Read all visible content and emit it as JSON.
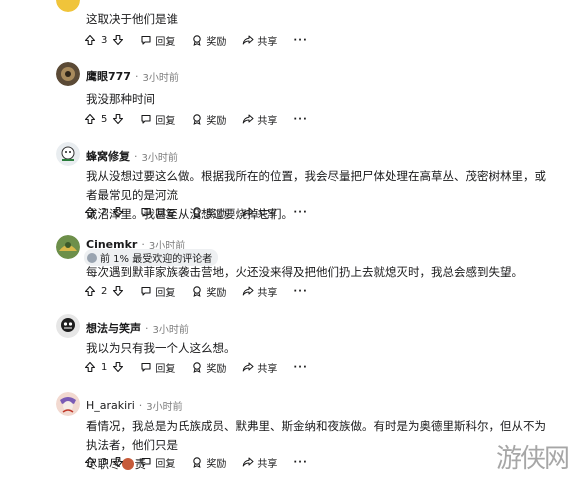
{
  "labels": {
    "reply": "回复",
    "award": "奖励",
    "share": "共享",
    "more": "···"
  },
  "comments": [
    {
      "author": "",
      "time": "",
      "text": "这取决于他们是谁",
      "votes": "3"
    },
    {
      "author": "鹰眼777",
      "time": "3小时前",
      "text": "我没那种时间",
      "votes": "5"
    },
    {
      "author": "蜂窝修复",
      "time": "3小时前",
      "text_line1": "我从没想过要这么做。根据我所在的位置，我会尽量把尸体处理在高草丛、茂密树林里，或者最常见的是河流",
      "text_line2": "或沼泽里。我甚至从没想过要烧掉它们。",
      "votes": "2"
    },
    {
      "author": "Cinemkr",
      "time": "3小时前",
      "flair": "前 1% 最受欢迎的评论者",
      "text": "每次遇到默菲家族袭击营地，火还没来得及把他们扔上去就熄灭时，我总会感到失望。",
      "votes": "2"
    },
    {
      "author": "想法与笑声",
      "time": "3小时前",
      "text": "我以为只有我一个人这么想。",
      "votes": "1"
    },
    {
      "author": "H_arakiri",
      "time": "3小时前",
      "text_line1": "看情况，我总是为氏族成员、默弗里、斯金纳和夜族做。有时是为奥德里斯科尔，但从不为执法者，他们只是",
      "text_line2a": "尽职尽",
      "text_line2b": "责",
      "votes": "3"
    }
  ],
  "watermark": "游侠网"
}
